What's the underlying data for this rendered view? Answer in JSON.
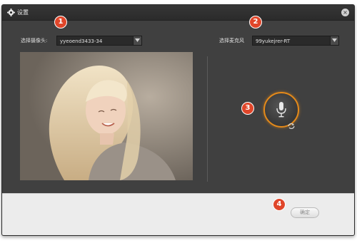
{
  "dialog": {
    "title": "设置",
    "close_symbol": "×"
  },
  "camera": {
    "label": "选择摄像头:",
    "selected": "yyeoend3433-34"
  },
  "microphone": {
    "label": "选择麦克风",
    "selected": "99yukejrer-RT"
  },
  "markers": {
    "m1": "1",
    "m2": "2",
    "m3": "3",
    "m4": "4"
  },
  "footer": {
    "ok_label": "确定"
  },
  "icons": {
    "gear": "gear-icon",
    "close": "close-icon",
    "dropdown": "chevron-down-icon",
    "mic": "microphone-icon",
    "refresh": "refresh-icon"
  },
  "colors": {
    "dialog_bg": "#404040",
    "mic_ring": "#e58a1a",
    "marker": "#e0462a"
  }
}
